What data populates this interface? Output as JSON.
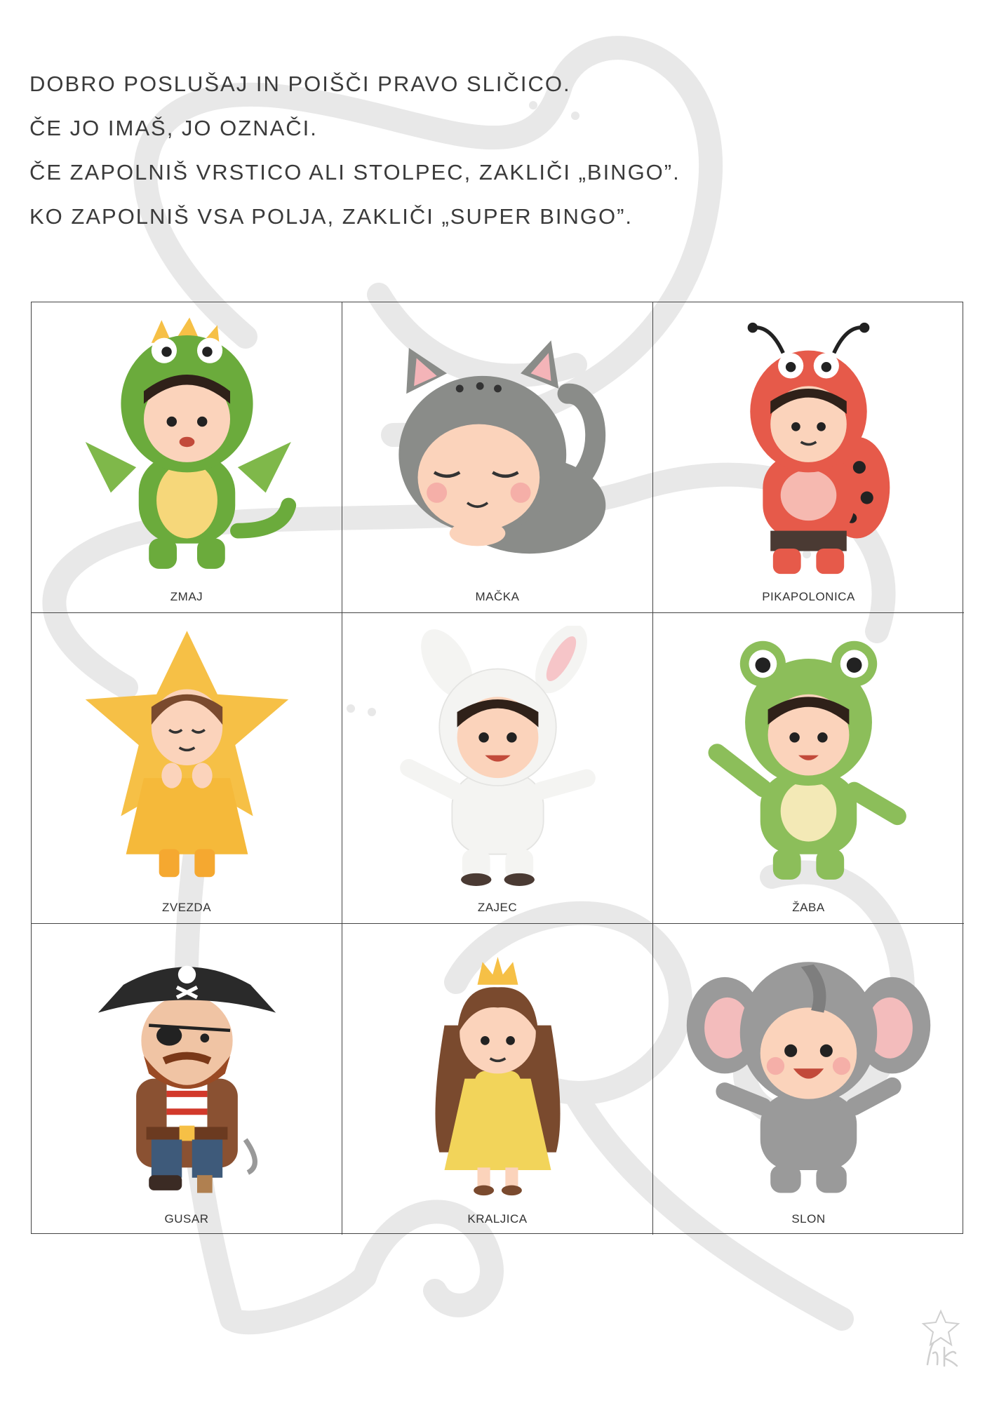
{
  "instructions": [
    "DOBRO POSLUŠAJ IN POIŠČI PRAVO SLIČICO.",
    "ČE JO IMAŠ, JO OZNAČI.",
    "ČE ZAPOLNIŠ VRSTICO ALI STOLPEC, ZAKLIČI „BINGO”.",
    "KO ZAPOLNIŠ VSA POLJA, ZAKLIČI „SUPER BINGO”."
  ],
  "cards": [
    {
      "label": "ZMAJ",
      "icon": "dragon-costume-child-icon"
    },
    {
      "label": "MAČKA",
      "icon": "cat-costume-child-icon"
    },
    {
      "label": "PIKAPOLONICA",
      "icon": "ladybug-costume-child-icon"
    },
    {
      "label": "ZVEZDA",
      "icon": "star-costume-child-icon"
    },
    {
      "label": "ZAJEC",
      "icon": "bunny-costume-child-icon"
    },
    {
      "label": "ŽABA",
      "icon": "frog-costume-child-icon"
    },
    {
      "label": "GUSAR",
      "icon": "pirate-icon"
    },
    {
      "label": "KRALJICA",
      "icon": "queen-icon"
    },
    {
      "label": "SLON",
      "icon": "elephant-costume-child-icon"
    }
  ],
  "colors": {
    "watermark": "#e6e6e6",
    "dragon": "#6bab3c",
    "cat": "#8a8c89",
    "ladybug": "#e65a4a",
    "star": "#f6c046",
    "bunny": "#f4f4f2",
    "frog": "#8cbe5a",
    "pirate_coat": "#8a5132",
    "queen_dress": "#f2d45a",
    "elephant": "#9a9a9a",
    "skin": "#fbd3bb",
    "hair": "#2f2119"
  }
}
